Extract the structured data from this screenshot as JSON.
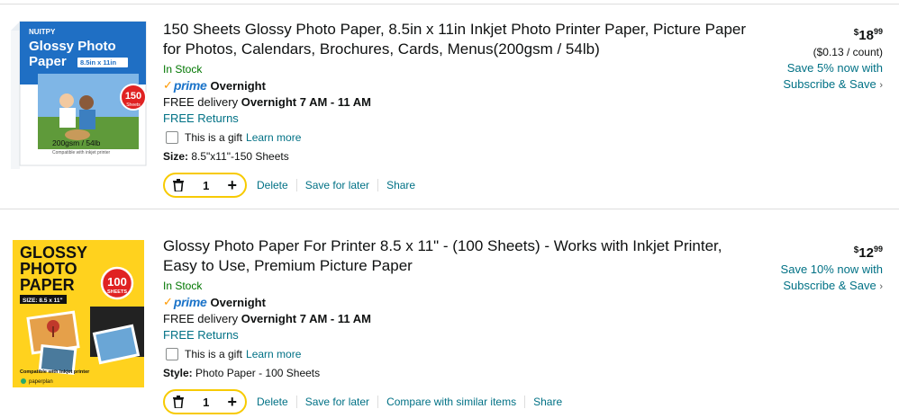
{
  "items": [
    {
      "title": "150 Sheets Glossy Photo Paper, 8.5in x 11in Inkjet Photo Printer Paper, Picture Paper for Photos, Calendars, Brochures, Cards, Menus(200gsm / 54lb)",
      "stock": "In Stock",
      "prime_label": "prime",
      "prime_speed": "Overnight",
      "delivery_prefix": "FREE delivery ",
      "delivery_window": "Overnight 7 AM - 11 AM",
      "returns": "FREE Returns",
      "gift_label": "This is a gift",
      "learn_more": "Learn more",
      "attr_label": "Size:",
      "attr_value": "8.5\"x11\"-150 Sheets",
      "quantity": "1",
      "actions": [
        "Delete",
        "Save for later",
        "Share"
      ],
      "price_symbol": "$",
      "price_whole": "18",
      "price_fraction": "99",
      "unit_price": "($0.13 / count)",
      "save_offer": "Save 5% now with",
      "subscribe": "Subscribe & Save",
      "image": {
        "brand": "NUITPY",
        "line1": "Glossy Photo",
        "line2": "Paper",
        "size": "8.5in x 11in",
        "badge_num": "150",
        "badge_word": "Sheets",
        "weight": "200gsm / 54lb",
        "compat": "Compatible with inkjet printer"
      }
    },
    {
      "title": "Glossy Photo Paper For Printer 8.5 x 11\" - (100 Sheets) - Works with Inkjet Printer, Easy to Use, Premium Picture Paper",
      "stock": "In Stock",
      "prime_label": "prime",
      "prime_speed": "Overnight",
      "delivery_prefix": "FREE delivery ",
      "delivery_window": "Overnight 7 AM - 11 AM",
      "returns": "FREE Returns",
      "gift_label": "This is a gift",
      "learn_more": "Learn more",
      "attr_label": "Style:",
      "attr_value": "Photo Paper - 100 Sheets",
      "quantity": "1",
      "actions": [
        "Delete",
        "Save for later",
        "Compare with similar items",
        "Share"
      ],
      "price_symbol": "$",
      "price_whole": "12",
      "price_fraction": "99",
      "save_offer": "Save 10% now with",
      "subscribe": "Subscribe & Save",
      "image": {
        "line1": "GLOSSY",
        "line2": "PHOTO",
        "line3": "PAPER",
        "size": "SIZE: 8.5 x 11\"",
        "badge_num": "100",
        "badge_word": "SHEETS",
        "compat": "Compatible with Inkjet printer",
        "brand": "paperplan"
      }
    }
  ],
  "colors": {
    "link": "#007185",
    "in_stock": "#007600",
    "prime_blue": "#1a73c9",
    "prime_check": "#ff9900",
    "qty_border": "#f7ca00",
    "item1_box": "#1f6fc4",
    "item2_box": "#ffd21e"
  }
}
